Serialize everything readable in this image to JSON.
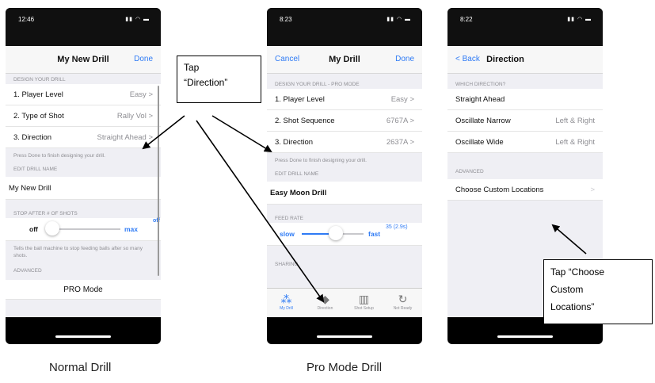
{
  "phone1": {
    "time": "12:46",
    "nav_title": "My New Drill",
    "nav_right": "Done",
    "section_design": "DESIGN YOUR DRILL",
    "rows": [
      {
        "label": "1. Player Level",
        "value": "Easy >"
      },
      {
        "label": "2. Type of Shot",
        "value": "Rally Vol >"
      },
      {
        "label": "3. Direction",
        "value": "Straight Ahead >"
      }
    ],
    "done_note": "Press Done to finish designing your drill.",
    "section_name": "EDIT DRILL NAME",
    "drill_name": "My New Drill",
    "section_stop": "STOP AFTER # OF SHOTS",
    "slider_off": "off",
    "slider_max": "max",
    "slider_off_right": "off",
    "stop_note": "Tells the ball machine to stop feeding balls after so many shots.",
    "section_advanced": "ADVANCED",
    "pro_mode": "PRO Mode"
  },
  "phone2": {
    "time": "8:23",
    "nav_left": "Cancel",
    "nav_title": "My Drill",
    "nav_right": "Done",
    "section_design": "DESIGN YOUR DRILL - PRO MODE",
    "rows": [
      {
        "label": "1. Player Level",
        "value": "Easy >"
      },
      {
        "label": "2. Shot Sequence",
        "value": "6767A >"
      },
      {
        "label": "3. Direction",
        "value": "2637A >"
      }
    ],
    "done_note": "Press Done to finish designing your drill.",
    "section_name": "EDIT DRILL NAME",
    "drill_name": "Easy Moon Drill",
    "section_feed": "FEED RATE",
    "feed_slow": "slow",
    "feed_fast": "fast",
    "feed_value": "35 (2.9s)",
    "section_sharing": "SHARING",
    "tabs": [
      {
        "label": "My Drill"
      },
      {
        "label": "Direction"
      },
      {
        "label": "Shot Setup"
      },
      {
        "label": "Not Ready"
      }
    ]
  },
  "phone3": {
    "time": "8:22",
    "nav_left": "< Back",
    "nav_title": "Direction",
    "section_which": "WHICH DIRECTION?",
    "rows": [
      {
        "label": "Straight Ahead",
        "value": ""
      },
      {
        "label": "Oscillate Narrow",
        "value": "Left & Right"
      },
      {
        "label": "Oscillate Wide",
        "value": "Left & Right"
      }
    ],
    "section_advanced": "ADVANCED",
    "custom": "Choose Custom Locations",
    "custom_chevron": ">"
  },
  "callouts": {
    "direction_line1": "Tap",
    "direction_line2": "“Direction”",
    "custom_line1": "Tap “Choose",
    "custom_line2": "Custom",
    "custom_line3": "Locations”"
  },
  "captions": {
    "normal": "Normal Drill",
    "pro": "Pro Mode Drill"
  },
  "colors": {
    "accent": "#2f7bf5",
    "background_grouped": "#efeff4"
  }
}
